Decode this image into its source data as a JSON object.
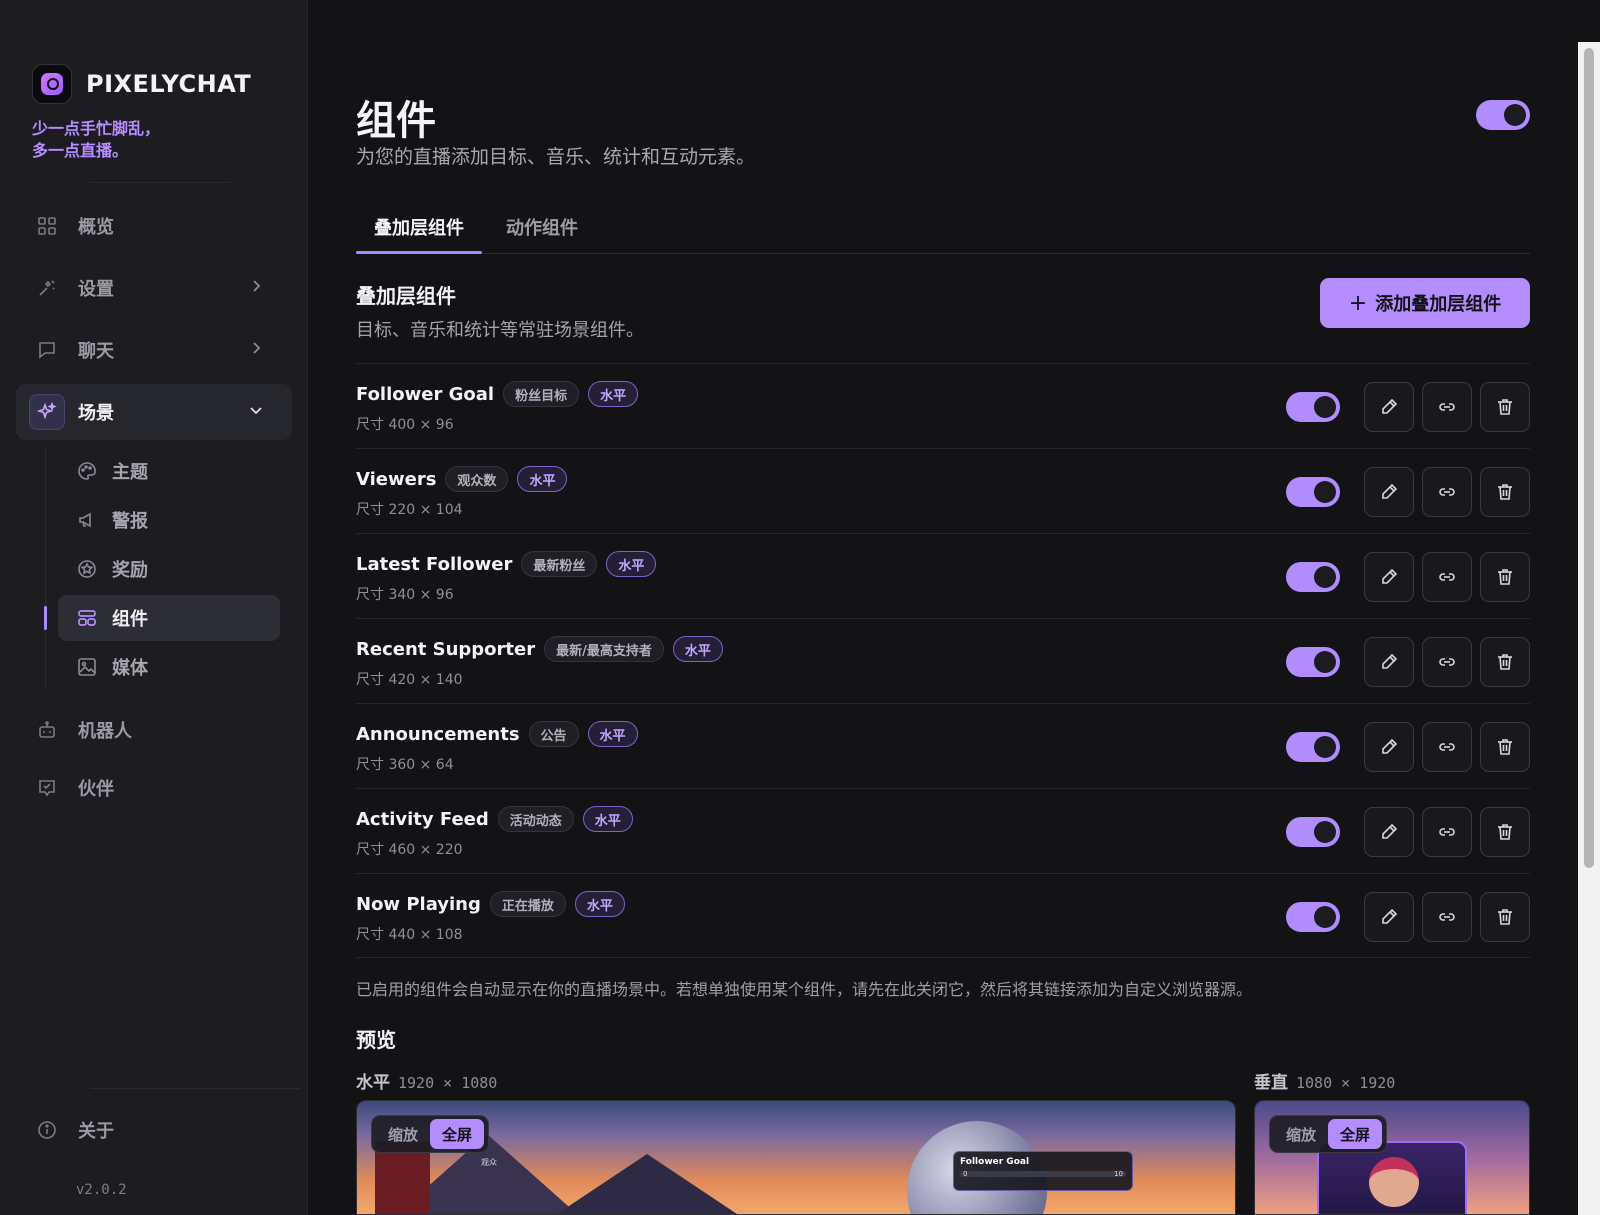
{
  "brand": {
    "name": "PIXELYCHAT",
    "tagline_line1": "少一点手忙脚乱，",
    "tagline_line2": "多一点直播。"
  },
  "sidebar": {
    "items": [
      {
        "label": "概览",
        "icon": "grid-icon"
      },
      {
        "label": "设置",
        "icon": "tools-icon"
      },
      {
        "label": "聊天",
        "icon": "chat-icon"
      },
      {
        "label": "场景",
        "icon": "sparkle-icon",
        "expanded": true
      },
      {
        "label": "机器人",
        "icon": "robot-icon"
      },
      {
        "label": "伙伴",
        "icon": "partner-icon"
      }
    ],
    "sub_items": [
      {
        "label": "主题",
        "icon": "palette-icon"
      },
      {
        "label": "警报",
        "icon": "megaphone-icon"
      },
      {
        "label": "奖励",
        "icon": "reward-icon"
      },
      {
        "label": "组件",
        "icon": "widgets-icon",
        "active": true
      },
      {
        "label": "媒体",
        "icon": "image-icon"
      }
    ],
    "about": "关于",
    "version": "v2.0.2"
  },
  "header": {
    "title": "组件",
    "subtitle": "为您的直播添加目标、音乐、统计和互动元素。",
    "master_toggle_on": true
  },
  "tabs": [
    {
      "label": "叠加层组件",
      "active": true
    },
    {
      "label": "动作组件",
      "active": false
    }
  ],
  "section": {
    "title": "叠加层组件",
    "subtitle": "目标、音乐和统计等常驻场景组件。",
    "add_button": "添加叠加层组件"
  },
  "widgets": [
    {
      "name": "Follower Goal",
      "tag": "粉丝目标",
      "orientation": "水平",
      "size": "尺寸 400 × 96",
      "enabled": true
    },
    {
      "name": "Viewers",
      "tag": "观众数",
      "orientation": "水平",
      "size": "尺寸 220 × 104",
      "enabled": true
    },
    {
      "name": "Latest Follower",
      "tag": "最新粉丝",
      "orientation": "水平",
      "size": "尺寸 340 × 96",
      "enabled": true
    },
    {
      "name": "Recent Supporter",
      "tag": "最新/最高支持者",
      "orientation": "水平",
      "size": "尺寸 420 × 140",
      "enabled": true
    },
    {
      "name": "Announcements",
      "tag": "公告",
      "orientation": "水平",
      "size": "尺寸 360 × 64",
      "enabled": true
    },
    {
      "name": "Activity Feed",
      "tag": "活动动态",
      "orientation": "水平",
      "size": "尺寸 460 × 220",
      "enabled": true
    },
    {
      "name": "Now Playing",
      "tag": "正在播放",
      "orientation": "水平",
      "size": "尺寸 440 × 108",
      "enabled": true
    }
  ],
  "note": "已启用的组件会自动显示在你的直播场景中。若想单独使用某个组件，请先在此关闭它，然后将其链接添加为自定义浏览器源。",
  "preview": {
    "title": "预览",
    "horizontal": {
      "label": "水平",
      "dims": "1920 × 1080"
    },
    "vertical": {
      "label": "垂直",
      "dims": "1080 × 1920"
    },
    "zoom_label": "缩放",
    "fullscreen_label": "全屏",
    "viewer_label": "观众",
    "goal_widget": {
      "title": "Follower Goal",
      "current": "0",
      "target": "10"
    }
  },
  "colors": {
    "accent": "#b48cff",
    "background": "#131316",
    "sidebar": "#1c1c21"
  }
}
